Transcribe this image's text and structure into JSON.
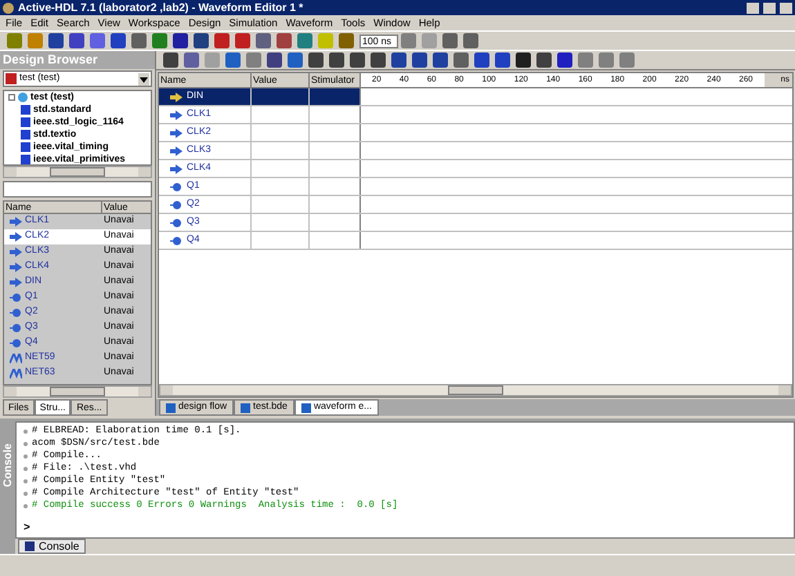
{
  "window": {
    "title": "Active-HDL 7.1 (laborator2 ,lab2) - Waveform Editor 1 *"
  },
  "menu": [
    "File",
    "Edit",
    "Search",
    "View",
    "Workspace",
    "Design",
    "Simulation",
    "Waveform",
    "Tools",
    "Window",
    "Help"
  ],
  "toolbar": {
    "time_field": "100 ns"
  },
  "design_browser": {
    "title": "Design Browser",
    "design_select": "test (test)",
    "tree": [
      {
        "label": "test (test)",
        "kind": "top"
      },
      {
        "label": "std.standard",
        "kind": "lib"
      },
      {
        "label": "ieee.std_logic_1164",
        "kind": "lib"
      },
      {
        "label": "std.textio",
        "kind": "lib"
      },
      {
        "label": "ieee.vital_timing",
        "kind": "lib"
      },
      {
        "label": "ieee.vital_primitives",
        "kind": "lib"
      }
    ],
    "columns": [
      "Name",
      "Value"
    ],
    "signals": [
      {
        "name": "CLK1",
        "value": "Unavai",
        "kind": "input",
        "selected": false
      },
      {
        "name": "CLK2",
        "value": "Unavai",
        "kind": "input",
        "selected": true
      },
      {
        "name": "CLK3",
        "value": "Unavai",
        "kind": "input",
        "selected": false
      },
      {
        "name": "CLK4",
        "value": "Unavai",
        "kind": "input",
        "selected": false
      },
      {
        "name": "DIN",
        "value": "Unavai",
        "kind": "input",
        "selected": false
      },
      {
        "name": "Q1",
        "value": "Unavai",
        "kind": "output",
        "selected": false
      },
      {
        "name": "Q2",
        "value": "Unavai",
        "kind": "output",
        "selected": false
      },
      {
        "name": "Q3",
        "value": "Unavai",
        "kind": "output",
        "selected": false
      },
      {
        "name": "Q4",
        "value": "Unavai",
        "kind": "output",
        "selected": false
      },
      {
        "name": "NET59",
        "value": "Unavai",
        "kind": "net",
        "selected": false
      },
      {
        "name": "NET63",
        "value": "Unavai",
        "kind": "net",
        "selected": false
      }
    ],
    "tabs": [
      {
        "label": "Files",
        "selected": false
      },
      {
        "label": "Stru...",
        "selected": true
      },
      {
        "label": "Res...",
        "selected": false
      }
    ]
  },
  "waveform": {
    "columns": [
      "Name",
      "Value",
      "Stimulator"
    ],
    "ruler": [
      "20",
      "40",
      "60",
      "80",
      "100",
      "120",
      "140",
      "160",
      "180",
      "200",
      "220",
      "240",
      "260"
    ],
    "unit": "ns",
    "rows": [
      {
        "name": "DIN",
        "kind": "input",
        "selected": true
      },
      {
        "name": "CLK1",
        "kind": "input",
        "selected": false
      },
      {
        "name": "CLK2",
        "kind": "input",
        "selected": false
      },
      {
        "name": "CLK3",
        "kind": "input",
        "selected": false
      },
      {
        "name": "CLK4",
        "kind": "input",
        "selected": false
      },
      {
        "name": "Q1",
        "kind": "output",
        "selected": false
      },
      {
        "name": "Q2",
        "kind": "output",
        "selected": false
      },
      {
        "name": "Q3",
        "kind": "output",
        "selected": false
      },
      {
        "name": "Q4",
        "kind": "output",
        "selected": false
      }
    ]
  },
  "doc_tabs": [
    {
      "label": "design flow",
      "selected": false
    },
    {
      "label": "test.bde",
      "selected": false
    },
    {
      "label": "waveform e...",
      "selected": true
    }
  ],
  "console": {
    "title": "Console",
    "lines": [
      {
        "text": "# ELBREAD: Elaboration time 0.1 [s].",
        "kind": "normal"
      },
      {
        "text": "acom $DSN/src/test.bde",
        "kind": "normal"
      },
      {
        "text": "# Compile...",
        "kind": "normal"
      },
      {
        "text": "# File: .\\test.vhd",
        "kind": "normal"
      },
      {
        "text": "# Compile Entity \"test\"",
        "kind": "normal"
      },
      {
        "text": "# Compile Architecture \"test\" of Entity \"test\"",
        "kind": "normal"
      },
      {
        "text": "# Compile success 0 Errors 0 Warnings  Analysis time :  0.0 [s]",
        "kind": "success"
      }
    ],
    "prompt": ">",
    "tabs": [
      {
        "label": "Console",
        "selected": true
      }
    ]
  }
}
